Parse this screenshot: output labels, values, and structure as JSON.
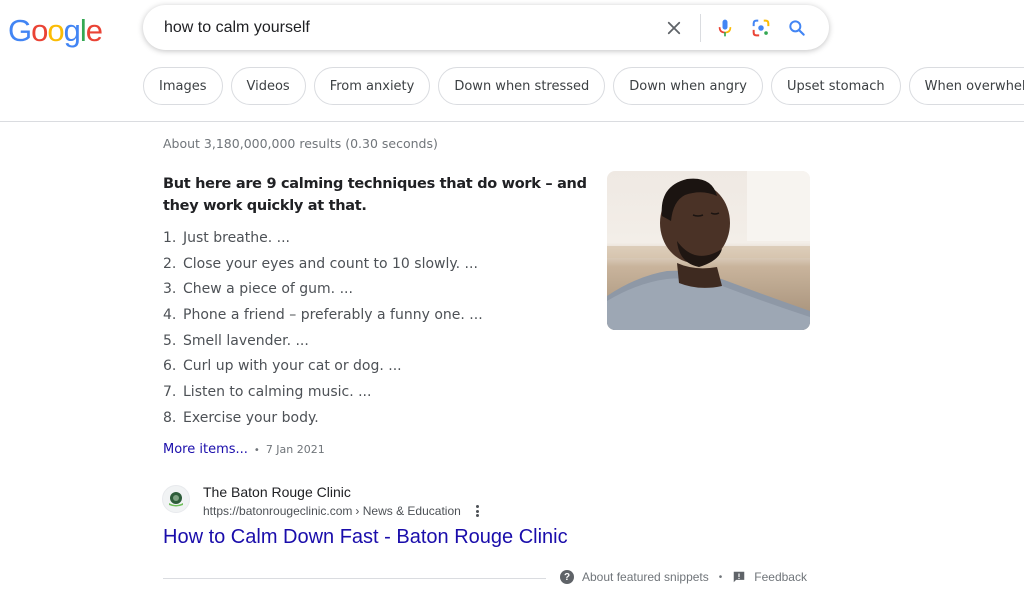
{
  "logo": {
    "letters": [
      "G",
      "o",
      "o",
      "g",
      "l",
      "e"
    ],
    "colors": [
      "#4285f4",
      "#ea4335",
      "#fbbc05",
      "#4285f4",
      "#34a853",
      "#ea4335"
    ]
  },
  "search": {
    "query": "how to calm yourself",
    "icons": [
      "clear-icon",
      "microphone-icon",
      "google-lens-icon",
      "search-icon"
    ]
  },
  "chips": [
    {
      "label": "Images"
    },
    {
      "label": "Videos"
    },
    {
      "label": "From anxiety"
    },
    {
      "label": "Down when stressed"
    },
    {
      "label": "Down when angry"
    },
    {
      "label": "Upset stomach"
    },
    {
      "label": "When overwhelmed"
    }
  ],
  "results": {
    "stats": "About 3,180,000,000 results (0.30 seconds)"
  },
  "featured_snippet": {
    "heading": "But here are 9 calming techniques that do work – and they work quickly at that.",
    "items": [
      {
        "num": "1.",
        "text": "Just breathe. ..."
      },
      {
        "num": "2.",
        "text": "Close your eyes and count to 10 slowly. ..."
      },
      {
        "num": "3.",
        "text": "Chew a piece of gum. ..."
      },
      {
        "num": "4.",
        "text": "Phone a friend – preferably a funny one. ..."
      },
      {
        "num": "5.",
        "text": "Smell lavender. ..."
      },
      {
        "num": "6.",
        "text": "Curl up with your cat or dog. ..."
      },
      {
        "num": "7.",
        "text": "Listen to calming music. ..."
      },
      {
        "num": "8.",
        "text": "Exercise your body."
      }
    ],
    "more_items": "More items...",
    "separator": "•",
    "date": "7 Jan 2021",
    "image_alt": "Man relaxing with eyes closed"
  },
  "source": {
    "site_name": "The Baton Rouge Clinic",
    "url": "https://batonrougeclinic.com",
    "breadcrumb": "› News & Education",
    "title": "How to Calm Down Fast - Baton Rouge Clinic"
  },
  "footer": {
    "about_label": "About featured snippets",
    "separator": "•",
    "feedback_label": "Feedback"
  },
  "colors": {
    "link": "#1a0dab",
    "muted": "#70757a",
    "border": "#dadce0"
  }
}
